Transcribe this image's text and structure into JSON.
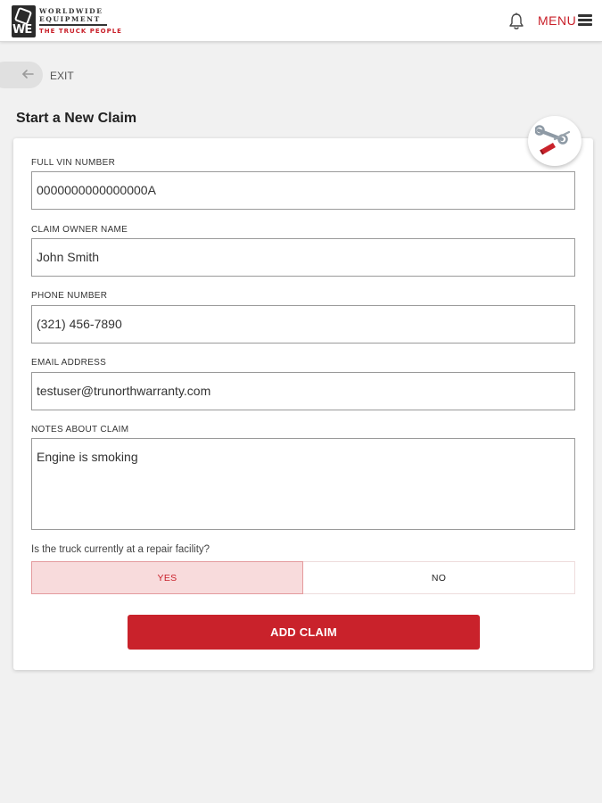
{
  "header": {
    "logo": {
      "mark": "WE",
      "line1": "WORLDWIDE",
      "line2": "EQUIPMENT",
      "tagline": "THE TRUCK PEOPLE"
    },
    "menu_label": "MENU"
  },
  "nav": {
    "exit_label": "EXIT"
  },
  "page": {
    "title": "Start a New Claim"
  },
  "form": {
    "vin": {
      "label": "FULL VIN NUMBER",
      "value": "0000000000000000A"
    },
    "owner": {
      "label": "CLAIM OWNER NAME",
      "value": "John Smith"
    },
    "phone": {
      "label": "PHONE NUMBER",
      "value": "(321) 456-7890"
    },
    "email": {
      "label": "EMAIL ADDRESS",
      "value": "testuser@trunorthwarranty.com"
    },
    "notes": {
      "label": "NOTES ABOUT CLAIM",
      "value": "Engine is smoking"
    },
    "repair_question": "Is the truck currently at a repair facility?",
    "yes_label": "YES",
    "no_label": "NO",
    "selected_option": "YES",
    "submit_label": "ADD CLAIM"
  },
  "icons": {
    "bell": "bell-icon",
    "menu": "hamburger-menu-icon",
    "back": "back-arrow-icon",
    "tools": "wrench-screwdriver-icon"
  },
  "colors": {
    "accent": "#c9222b",
    "selected_fill": "#f8dbdc",
    "background": "#f1f1f1"
  }
}
